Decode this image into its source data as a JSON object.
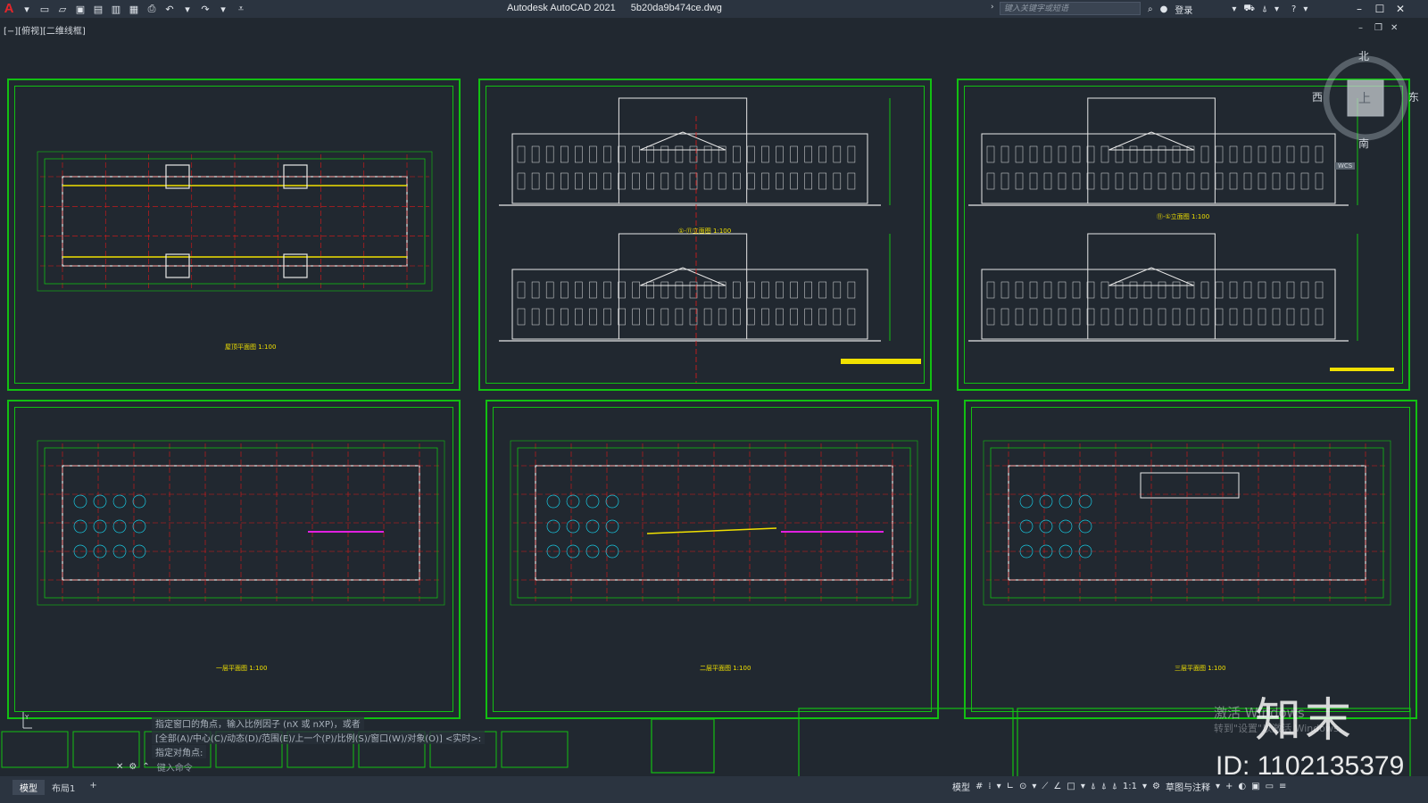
{
  "app": {
    "logo": "A",
    "title": "Autodesk AutoCAD 2021",
    "filename": "5b20da9b474ce.dwg"
  },
  "search": {
    "placeholder": "键入关键字或短语"
  },
  "account": {
    "login_label": "登录"
  },
  "viewport": {
    "label": "[−][俯视][二维线框]"
  },
  "viewcube": {
    "north": "北",
    "south": "南",
    "east": "东",
    "west": "西",
    "face": "上",
    "wcs": "WCS"
  },
  "command": {
    "line1": "指定窗口的角点，输入比例因子 (nX 或 nXP)，或者",
    "line2": "[全部(A)/中心(C)/动态(D)/范围(E)/上一个(P)/比例(S)/窗口(W)/对象(O)] <实时>:",
    "line3": "指定对角点:",
    "input_placeholder": "键入命令"
  },
  "layouts": [
    {
      "label": "模型",
      "active": true
    },
    {
      "label": "布局1",
      "active": false
    }
  ],
  "add_layout": "+",
  "status": {
    "model": "模型",
    "scale": "1:1",
    "workspace": "草图与注释"
  },
  "sheets": [
    {
      "title": "屋顶平面图 1:100"
    },
    {
      "title": "①-⑪立面图 1:100"
    },
    {
      "title": "⑪-①立面图 1:100"
    },
    {
      "title": "一层平面图 1:100"
    },
    {
      "title": "二层平面图 1:100"
    },
    {
      "title": "三层平面图 1:100"
    }
  ],
  "overlay": {
    "activate_line1": "激活 Windows",
    "activate_line2": "转到\"设置\"以激活 Windows。",
    "brand": "知末",
    "id_text": "ID: 1102135379"
  },
  "colors": {
    "background": "#212830",
    "frame_green": "#12c012",
    "axis_red": "#e01818",
    "line_white": "#e8e8e8",
    "yellow": "#f0e000",
    "cyan": "#19c8e0",
    "magenta": "#e020e0"
  }
}
